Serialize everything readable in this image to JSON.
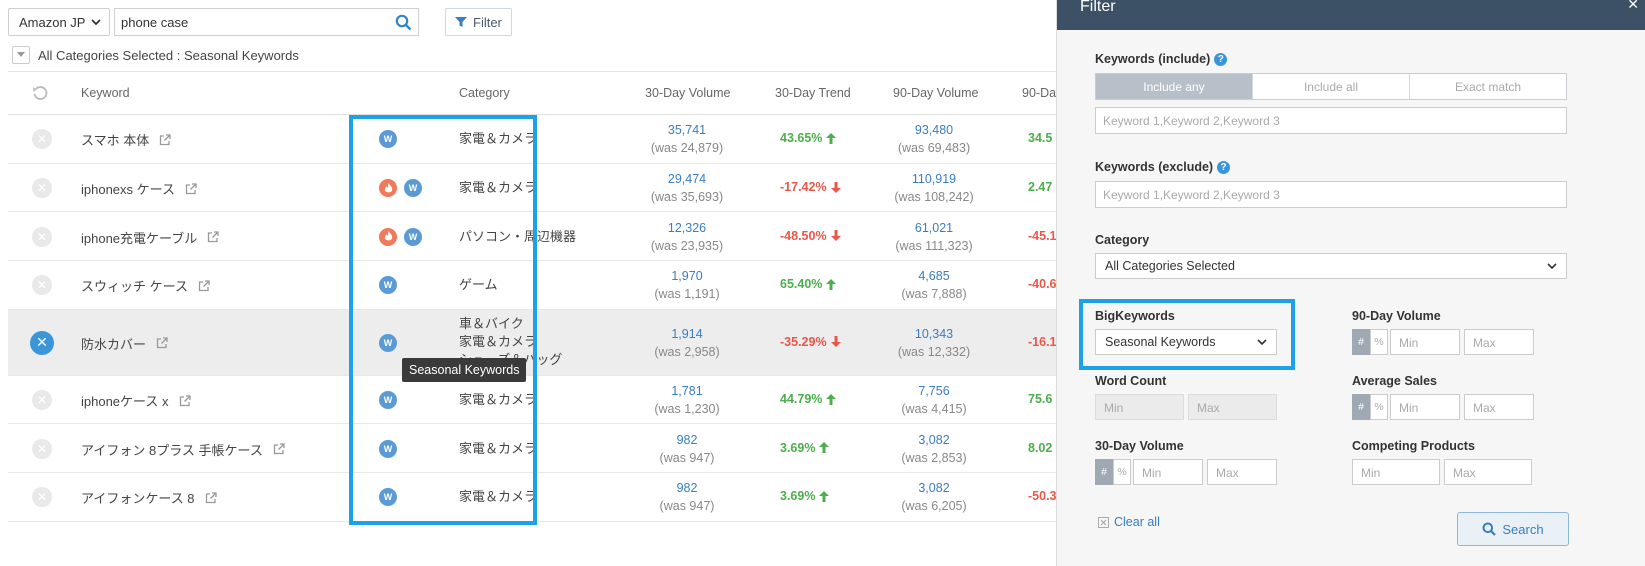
{
  "toolbar": {
    "marketplace": "Amazon JP",
    "search_value": "phone case",
    "filter_label": "Filter",
    "category_summary": "All Categories Selected : Seasonal Keywords"
  },
  "table": {
    "columns": [
      "Keyword",
      "Category",
      "30-Day Volume",
      "30-Day Trend",
      "90-Day Volume",
      "90-Da"
    ],
    "rows": [
      {
        "keyword": "スマホ 本体",
        "icons": [
          "w"
        ],
        "category": "家電＆カメラ",
        "vol30": "35,741",
        "was30": "(was 24,879)",
        "trend30": "43.65%",
        "dir": "up",
        "vol90": "93,480",
        "was90": "(was 69,483)",
        "trend90": "34.5",
        "dir90": "up"
      },
      {
        "keyword": "iphonexs ケース",
        "icons": [
          "f",
          "w"
        ],
        "category": "家電＆カメラ",
        "vol30": "29,474",
        "was30": "(was 35,693)",
        "trend30": "-17.42%",
        "dir": "down",
        "vol90": "110,919",
        "was90": "(was 108,242)",
        "trend90": "2.47",
        "dir90": "up"
      },
      {
        "keyword": "iphone充電ケーブル",
        "icons": [
          "f",
          "w"
        ],
        "category": "パソコン・周辺機器",
        "vol30": "12,326",
        "was30": "(was 23,935)",
        "trend30": "-48.50%",
        "dir": "down",
        "vol90": "61,021",
        "was90": "(was 111,323)",
        "trend90": "-45.1",
        "dir90": "down"
      },
      {
        "keyword": "スウィッチ ケース",
        "icons": [
          "w"
        ],
        "category": "ゲーム",
        "vol30": "1,970",
        "was30": "(was 1,191)",
        "trend30": "65.40%",
        "dir": "up",
        "vol90": "4,685",
        "was90": "(was 7,888)",
        "trend90": "-40.6",
        "dir90": "down"
      },
      {
        "keyword": "防水カバー",
        "icons": [
          "w"
        ],
        "category_lines": [
          "車＆バイク",
          "家電＆カメラ",
          "シューズ＆バッグ"
        ],
        "vol30": "1,914",
        "was30": "(was 2,958)",
        "trend30": "-35.29%",
        "dir": "down",
        "vol90": "10,343",
        "was90": "(was 12,332)",
        "trend90": "-16.1",
        "dir90": "down"
      },
      {
        "keyword": "iphoneケース x",
        "icons": [
          "w"
        ],
        "category": "家電＆カメラ",
        "vol30": "1,781",
        "was30": "(was 1,230)",
        "trend30": "44.79%",
        "dir": "up",
        "vol90": "7,756",
        "was90": "(was 4,415)",
        "trend90": "75.6",
        "dir90": "up"
      },
      {
        "keyword": "アイフォン 8プラス 手帳ケース",
        "icons": [
          "w"
        ],
        "category": "家電＆カメラ",
        "vol30": "982",
        "was30": "(was 947)",
        "trend30": "3.69%",
        "dir": "up",
        "vol90": "3,082",
        "was90": "(was 2,853)",
        "trend90": "8.02",
        "dir90": "up"
      },
      {
        "keyword": "アイフォンケース 8",
        "icons": [
          "w"
        ],
        "category": "家電＆カメラ",
        "vol30": "982",
        "was30": "(was 947)",
        "trend30": "3.69%",
        "dir": "up",
        "vol90": "3,082",
        "was90": "(was 6,205)",
        "trend90": "-50.3",
        "dir90": "down"
      }
    ],
    "tooltip": "Seasonal Keywords"
  },
  "filter_panel": {
    "title": "Filter",
    "keywords_include_label": "Keywords (include)",
    "match_options": [
      "Include any",
      "Include all",
      "Exact match"
    ],
    "keywords_placeholder": "Keyword 1,Keyword 2,Keyword 3",
    "keywords_exclude_label": "Keywords (exclude)",
    "category_label": "Category",
    "category_value": "All Categories Selected",
    "bigkeywords_label": "BigKeywords",
    "bigkeywords_value": "Seasonal Keywords",
    "vol90_label": "90-Day Volume",
    "word_count_label": "Word Count",
    "avg_sales_label": "Average Sales",
    "vol30_label": "30-Day Volume",
    "competing_label": "Competing Products",
    "min": "Min",
    "max": "Max",
    "hash": "#",
    "pct": "%",
    "clear_all": "Clear all",
    "search_label": "Search"
  },
  "colors": {
    "accent": "#1da1e8",
    "panel_header": "#3d5166",
    "up": "#4cae4c",
    "down": "#e8574a"
  }
}
